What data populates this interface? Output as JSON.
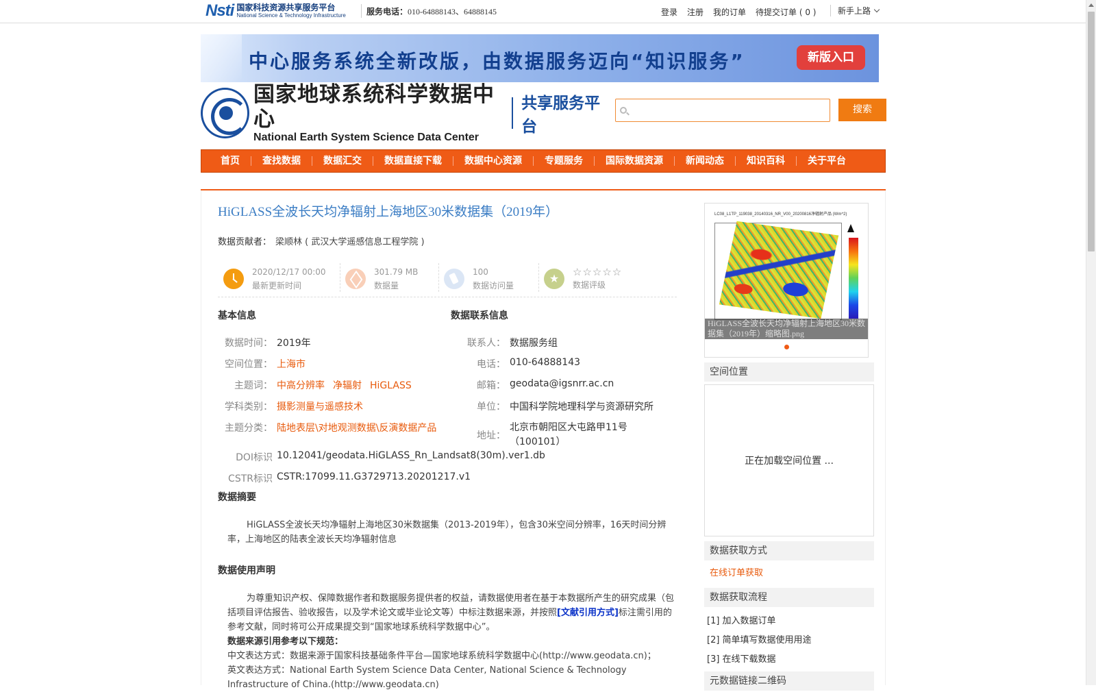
{
  "topbar": {
    "nsti_logo_mark": "Nsti",
    "nsti_logo_cn": "国家科技资源共享服务平台",
    "nsti_logo_en": "National Science & Technology Infrastructure",
    "phone_label": "服务电话：",
    "phone_value": "010-64888143、64888145",
    "links": [
      "登录",
      "注册",
      "我的订单",
      "待提交订单 ( 0 )"
    ],
    "guide": "新手上路"
  },
  "banner": {
    "text": "中心服务系统全新改版，由数据服务迈向“知识服务”",
    "button": "新版入口"
  },
  "site": {
    "name_cn": "国家地球系统科学数据中心",
    "name_en": "National Earth System Science Data Center",
    "platform": "共享服务平台"
  },
  "search": {
    "placeholder": "",
    "button": "搜索"
  },
  "nav": [
    "首页",
    "查找数据",
    "数据汇交",
    "数据直接下载",
    "数据中心资源",
    "专题服务",
    "国际数据资源",
    "新闻动态",
    "知识百科",
    "关于平台"
  ],
  "dataset": {
    "title": "HiGLASS全波长天均净辐射上海地区30米数据集（2019年）",
    "contributor_label": "数据贡献者：",
    "contributor": "梁顺林 ( 武汉大学遥感信息工程学院 )",
    "stats": {
      "updated_value": "2020/12/17 00:00",
      "updated_label": "最新更新时间",
      "size_value": "301.79 MB",
      "size_label": "数据量",
      "visits_value": "100",
      "visits_label": "数据访问量",
      "rating_stars": "☆☆☆☆☆",
      "rating_label": "数据评级"
    },
    "basic": {
      "heading": "基本信息",
      "time_label": "数据时间：",
      "time": "2019年",
      "location_label": "空间位置：",
      "location": "上海市",
      "keywords_label": "主题词：",
      "keywords": [
        "中高分辨率",
        "净辐射",
        "HiGLASS"
      ],
      "discipline_label": "学科类别：",
      "discipline": "摄影测量与遥感技术",
      "category_label": "主题分类：",
      "category": "陆地表层\\对地观测数据\\反演数据产品",
      "doi_label": "DOI标识",
      "doi": "10.12041/geodata.HiGLASS_Rn_Landsat8(30m).ver1.db",
      "cstr_label": "CSTR标识",
      "cstr": "CSTR:17099.11.G3729713.20201217.v1"
    },
    "contact": {
      "heading": "数据联系信息",
      "person_label": "联系人：",
      "person": "数据服务组",
      "phone_label": "电话：",
      "phone": "010-64888143",
      "email_label": "邮箱：",
      "email": "geodata@igsnrr.ac.cn",
      "unit_label": "单位：",
      "unit": "中国科学院地理科学与资源研究所",
      "address_label": "地址：",
      "address_line1": "北京市朝阳区大屯路甲11号",
      "address_line2": "（100101）"
    },
    "abstract_heading": "数据摘要",
    "abstract": "HiGLASS全波长天均净辐射上海地区30米数据集（2013-2019年），包含30米空间分辨率，16天时间分辨率，上海地区的陆表全波长天均净辐射信息",
    "usage_heading": "数据使用声明",
    "usage_p1_a": "为尊重知识产权、保障数据作者和数据服务提供者的权益，请数据使用者在基于本数据所产生的研究成果（包括项目评估报告、验收报告，以及学术论文或毕业论文等）中标注数据来源，并按照",
    "usage_link": "[文献引用方式]",
    "usage_p1_b": "标注需引用的参考文献，同时将可公开成果提交到“国家地球系统科学数据中心”。",
    "usage_ref_heading": "数据来源引用参考以下规范：",
    "usage_cn": "中文表达方式：数据来源于国家科技基础条件平台—国家地球系统科学数据中心(http://www.geodata.cn)；",
    "usage_en": "英文表达方式：National Earth System Science Data Center, National Science & Technology Infrastructure of China.(http://www.geodata.cn)"
  },
  "sidebar": {
    "thumb_map_title": "LC08_L1TP_119038_20140316_NR_V00_20200816净辐射产品 (Wm^2)",
    "thumb_caption": "HiGLASS全波长天均净辐射上海地区30米数据集（2019年）缩略图.png",
    "location_heading": "空间位置",
    "location_loading": "正在加载空间位置 ...",
    "access_heading": "数据获取方式",
    "access_link": "在线订单获取",
    "process_heading": "数据获取流程",
    "steps": [
      "[1] 加入数据订单",
      "[2] 简单填写数据使用用途",
      "[3] 在线下载数据"
    ],
    "qr_heading": "元数据链接二维码"
  }
}
